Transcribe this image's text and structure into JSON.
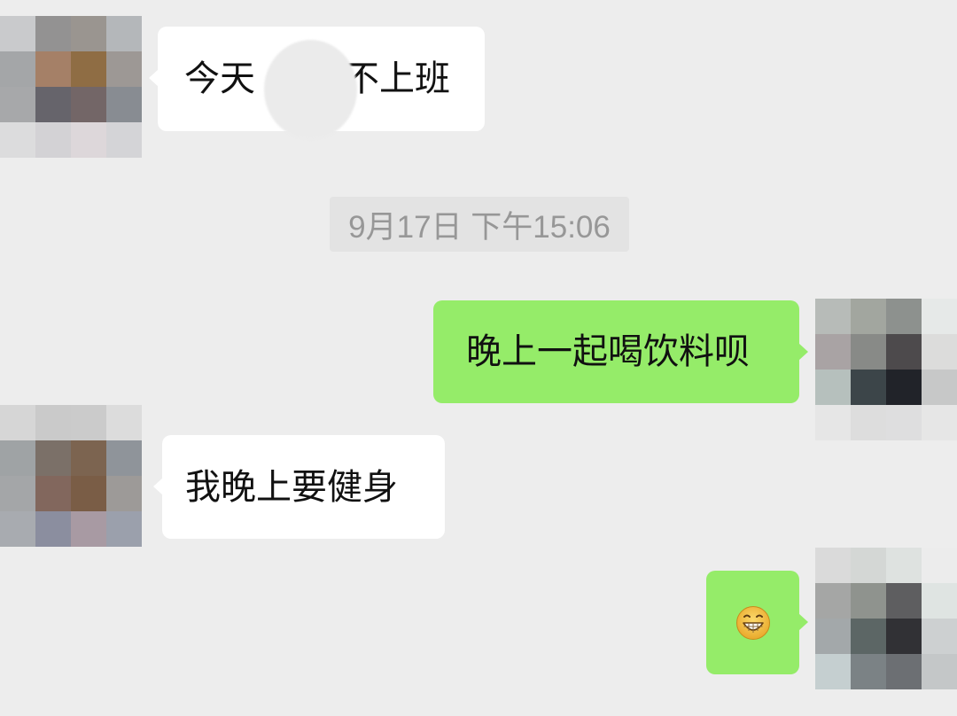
{
  "chat": {
    "messages": [
      {
        "direction": "incoming",
        "text": "今天不上班",
        "text_left": "今天",
        "text_right": "不上班",
        "redacted_segment": true
      },
      {
        "direction": "outgoing",
        "text": "晚上一起喝饮料呗"
      },
      {
        "direction": "incoming",
        "text": "我晚上要健身"
      },
      {
        "direction": "outgoing",
        "emoji": "grin-emoji"
      }
    ],
    "timestamp": "9月17日 下午15:06"
  },
  "colors": {
    "background": "#ededed",
    "incoming_bubble": "#ffffff",
    "outgoing_bubble": "#95ec69",
    "timestamp_text": "#979797",
    "emoji_face": "#f6c444"
  },
  "avatars": {
    "contact_top": [
      [
        "#c9cacc",
        "#939292",
        "#9a9590",
        "#b4b7ba"
      ],
      [
        "#a4a6a8",
        "#a58067",
        "#8f6d44",
        "#9d9895"
      ],
      [
        "#a7a8aa",
        "#66646b",
        "#736667",
        "#888c92"
      ],
      [
        "#dcdcdd",
        "#d3d2d5",
        "#ddd7da",
        "#d4d4d7"
      ]
    ],
    "self_top": [
      [
        "#b7bbb8",
        "#a2a69f",
        "#8d918e",
        "#e6e9e8"
      ],
      [
        "#a9a3a4",
        "#888a87",
        "#4d4a4c",
        "#dcdcdb"
      ],
      [
        "#b6c0bd",
        "#3c4549",
        "#212329",
        "#c7c8c8"
      ],
      [
        "#e6e6e6",
        "#dddddd",
        "#dededf",
        "#e6e6e6"
      ]
    ],
    "contact_bottom": [
      [
        "#d6d6d6",
        "#cacaca",
        "#cbcbcb",
        "#dcdcdc"
      ],
      [
        "#9fa3a5",
        "#7b7068",
        "#7c6450",
        "#8f949a"
      ],
      [
        "#a4a6a8",
        "#82675d",
        "#7a5d46",
        "#9d9a98"
      ],
      [
        "#a8abb0",
        "#8b8e9f",
        "#a89aa3",
        "#9ba0ac"
      ]
    ],
    "self_bottom": [
      [
        "#dadada",
        "#d4d7d5",
        "#dee2e0",
        "#ececec"
      ],
      [
        "#a5a6a5",
        "#8f938e",
        "#5e5e60",
        "#dfe4e2"
      ],
      [
        "#a3a8aa",
        "#5c6665",
        "#313135",
        "#cdd0d1"
      ],
      [
        "#c5cfd0",
        "#7b8285",
        "#6c6f73",
        "#c4c7c8"
      ]
    ]
  }
}
